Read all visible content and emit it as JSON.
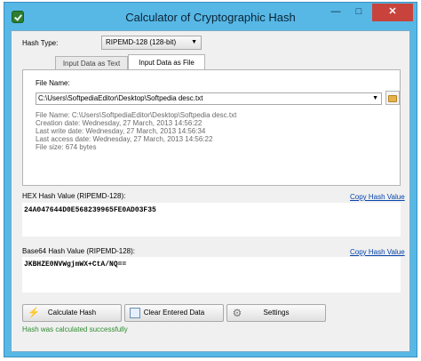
{
  "window": {
    "title": "Calculator of Cryptographic Hash",
    "controls": {
      "minimize": "—",
      "maximize": "□",
      "close": "✕"
    }
  },
  "hash_type": {
    "label": "Hash Type:",
    "selected": "RIPEMD-128 (128-bit)"
  },
  "tabs": [
    {
      "label": "Input Data as Text",
      "active": false
    },
    {
      "label": "Input Data as File",
      "active": true
    }
  ],
  "file": {
    "label": "File Name:",
    "path": "C:\\Users\\SoftpediaEditor\\Desktop\\Softpedia desc.txt",
    "info": [
      "File Name: C:\\Users\\SoftpediaEditor\\Desktop\\Softpedia desc.txt",
      "Creation date: Wednesday, 27 March, 2013 14:56:22",
      "Last write date: Wednesday, 27 March, 2013 14:56:34",
      "Last access date: Wednesday, 27 March, 2013 14:56:22",
      "File size: 674 bytes"
    ]
  },
  "hex": {
    "label": "HEX Hash Value (RIPEMD-128):",
    "copy": "Copy Hash Value",
    "value": "24A047644D0E568239965FE0AD03F35"
  },
  "base64": {
    "label": "Base64 Hash Value (RIPEMD-128):",
    "copy": "Copy Hash Value",
    "value": "JKBHZE0NVWgjmWX+CtA/NQ=="
  },
  "buttons": {
    "calculate": "Calculate Hash",
    "clear": "Clear Entered Data",
    "settings": "Settings"
  },
  "status": "Hash was calculated successfully",
  "colors": {
    "title_bar": "#57b8e6",
    "close_button": "#c7433c",
    "link": "#0645ad",
    "status_ok": "#2f8c2f"
  },
  "icons": {
    "app": "shield-check-icon",
    "browse": "folder-icon",
    "calculate": "lightning-icon",
    "clear": "document-icon",
    "settings": "gear-icon"
  }
}
